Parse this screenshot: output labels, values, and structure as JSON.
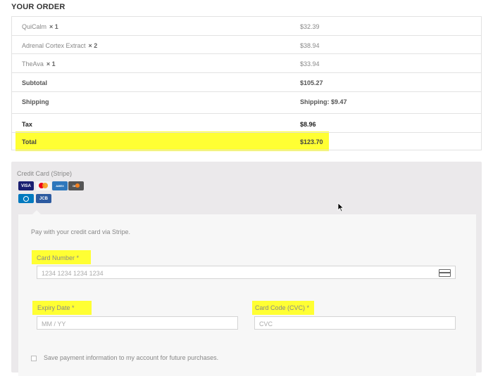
{
  "order": {
    "heading": "YOUR ORDER",
    "items": [
      {
        "name": "QuiCalm",
        "qty": "× 1",
        "price": "$32.39"
      },
      {
        "name": "Adrenal Cortex Extract",
        "qty": "× 2",
        "price": "$38.94"
      },
      {
        "name": "TheAva",
        "qty": "× 1",
        "price": "$33.94"
      }
    ],
    "subtotal_label": "Subtotal",
    "subtotal_value": "$105.27",
    "shipping_label": "Shipping",
    "shipping_value": "Shipping: $9.47",
    "tax_label": "Tax",
    "tax_value": "$8.96",
    "total_label": "Total",
    "total_value": "$123.70"
  },
  "payment": {
    "method_title": "Credit Card (Stripe)",
    "card_brands": [
      "VISA",
      "mastercard",
      "AMERICAN EXPRESS",
      "DISCOVER",
      "diners",
      "JCB"
    ],
    "note": "Pay with your credit card via Stripe.",
    "card_number": {
      "label": "Card Number *",
      "placeholder": "1234 1234 1234 1234"
    },
    "expiry": {
      "label": "Expiry Date *",
      "placeholder": "MM / YY"
    },
    "cvc": {
      "label": "Card Code (CVC) *",
      "placeholder": "CVC"
    },
    "save_label": "Save payment information to my account for future purchases."
  },
  "colors": {
    "highlight": "#ffff33",
    "panel": "#ebe9eb"
  }
}
